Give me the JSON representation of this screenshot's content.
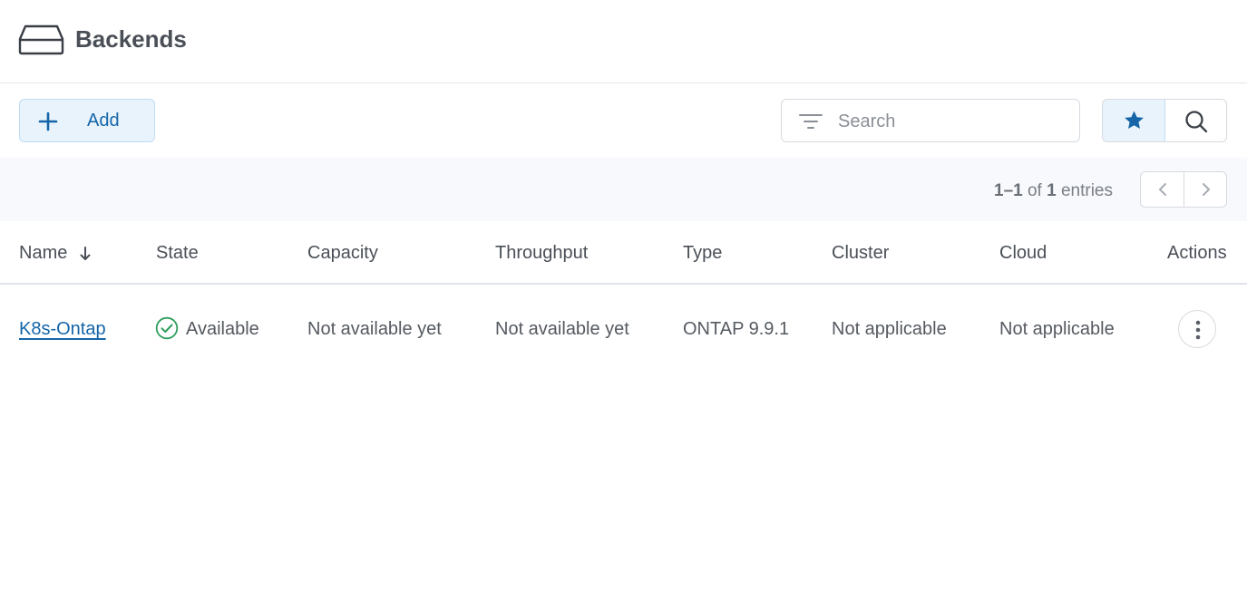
{
  "page": {
    "title": "Backends",
    "icon": "hard-drive-icon"
  },
  "toolbar": {
    "add_label": "Add",
    "search_placeholder": "Search",
    "search_value": "",
    "favorites_active": true
  },
  "pagination": {
    "range": "1–1",
    "of_text": " of ",
    "total": "1",
    "entries_text": " entries"
  },
  "table": {
    "columns": [
      "Name",
      "State",
      "Capacity",
      "Throughput",
      "Type",
      "Cluster",
      "Cloud",
      "Actions"
    ],
    "sorted_by": "Name",
    "sort_direction": "descending",
    "rows": [
      {
        "name": "K8s-Ontap",
        "state": "Available",
        "capacity": "Not available yet",
        "throughput": "Not available yet",
        "type": "ONTAP 9.9.1",
        "cluster": "Not applicable",
        "cloud": "Not applicable"
      }
    ]
  },
  "colors": {
    "accent": "#1565a8",
    "accent_bg": "#e8f3fc",
    "success": "#2e9e5b",
    "border": "#d6dadf"
  }
}
